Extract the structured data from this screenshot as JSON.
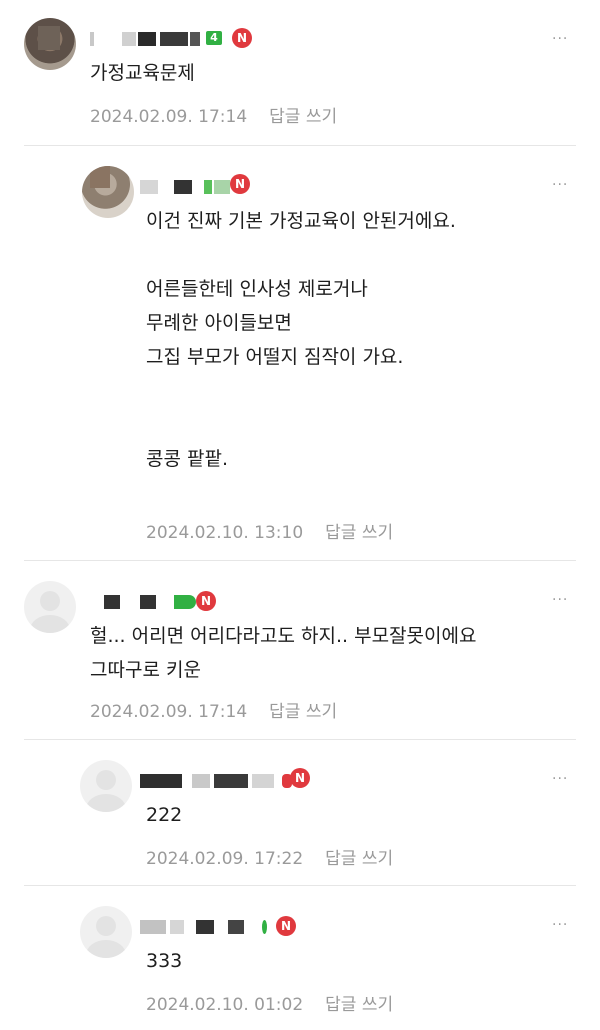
{
  "comments": [
    {
      "text": "가정교육문제",
      "date": "2024.02.09. 17:14",
      "reply_label": "답글 쓰기",
      "badge": "N",
      "level": "4",
      "more": "..."
    },
    {
      "text": "이건 진짜 기본 가정교육이 안된거에요.\n\n어른들한테 인사성 제로거나\n무례한 아이들보면\n그집 부모가 어떨지 짐작이 가요.\n\n\n콩콩 팥팥.",
      "date": "2024.02.10. 13:10",
      "reply_label": "답글 쓰기",
      "badge": "N",
      "more": "..."
    },
    {
      "text": "헐... 어리면 어리다라고도 하지.. 부모잘못이에요\n그따구로 키운",
      "date": "2024.02.09. 17:14",
      "reply_label": "답글 쓰기",
      "badge": "N",
      "more": "..."
    },
    {
      "text": "222",
      "date": "2024.02.09. 17:22",
      "reply_label": "답글 쓰기",
      "badge": "N",
      "more": "..."
    },
    {
      "text": "333",
      "date": "2024.02.10. 01:02",
      "reply_label": "답글 쓰기",
      "badge": "N",
      "more": "..."
    }
  ],
  "colors": {
    "badge": "#e0393e",
    "level": "#31b043",
    "meta": "#9a9a9a",
    "divider": "#e6e6e6"
  }
}
